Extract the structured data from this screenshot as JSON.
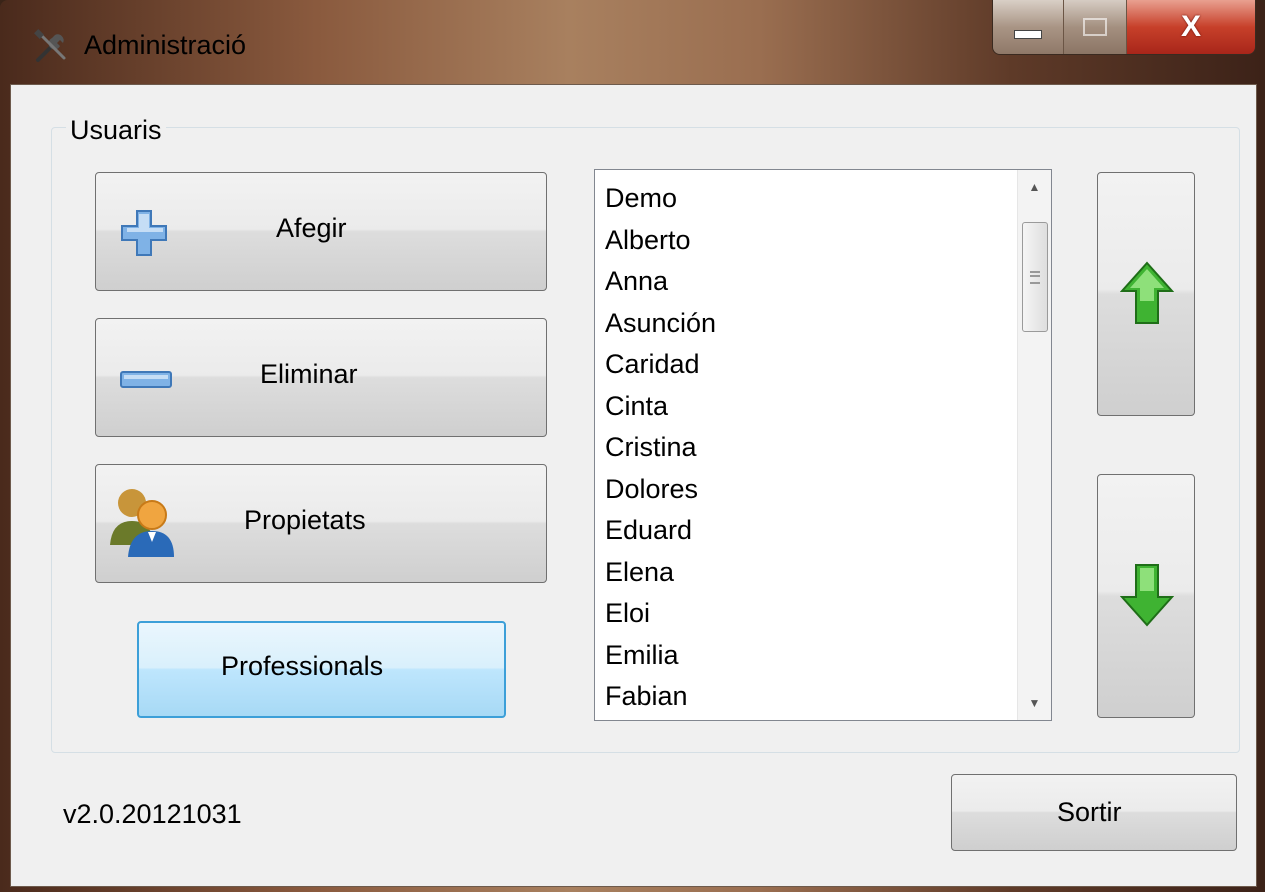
{
  "window": {
    "title": "Administració",
    "icon": "tools-icon"
  },
  "controls": {
    "minimize_icon": "minimize-icon",
    "maximize_icon": "maximize-icon",
    "close_label": "X"
  },
  "group": {
    "title": "Usuaris"
  },
  "buttons": {
    "add": {
      "label": "Afegir",
      "icon": "plus-icon"
    },
    "remove": {
      "label": "Eliminar",
      "icon": "minus-icon"
    },
    "properties": {
      "label": "Propietats",
      "icon": "users-icon"
    },
    "professionals": {
      "label": "Professionals"
    },
    "move_up": {
      "icon": "arrow-up-icon"
    },
    "move_down": {
      "icon": "arrow-down-icon"
    },
    "exit": {
      "label": "Sortir"
    }
  },
  "users_list": {
    "items": [
      "Demo",
      "Alberto",
      "Anna",
      "Asunción",
      "Caridad",
      "Cinta",
      "Cristina",
      "Dolores",
      "Eduard",
      "Elena",
      "Eloi",
      "Emilia",
      "Fabian"
    ]
  },
  "footer": {
    "version": "v2.0.20121031"
  },
  "colors": {
    "accent_blue": "#3c9fd8",
    "arrow_green": "#2f9e2a",
    "close_red": "#c7402a"
  }
}
